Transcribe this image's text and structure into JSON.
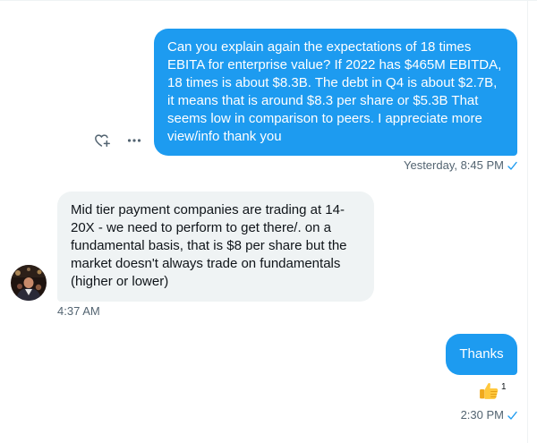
{
  "conversation": {
    "messages": [
      {
        "direction": "outgoing",
        "text": "Can you explain again the expectations of 18 times EBITA for enterprise value? If 2022 has $465M EBITDA, 18 times is about $8.3B. The debt in Q4 is about $2.7B, it means that is around $8.3 per share or $5.3B That seems low in comparison to peers. I appreciate more view/info thank you",
        "timestamp": "Yesterday, 8:45 PM",
        "icons": {
          "react": "heart-plus-icon",
          "more": "more-options-icon",
          "status": "checkmark-icon"
        }
      },
      {
        "direction": "incoming",
        "text": "Mid tier payment companies are trading at 14-20X - we need to perform to get there/. on a fundamental basis, that is $8 per share but the market doesn't always trade on fundamentals (higher or lower)",
        "timestamp": "4:37 AM",
        "icons": {
          "avatar": "user-avatar"
        }
      },
      {
        "direction": "outgoing",
        "text": "Thanks",
        "timestamp": "2:30 PM",
        "reaction": {
          "emoji": "thumbs-up-icon",
          "count": "1"
        },
        "icons": {
          "status": "checkmark-icon"
        }
      }
    ]
  },
  "colors": {
    "accent": "#1d9bf0",
    "incoming_bubble": "#eff3f4",
    "meta_text": "#536471",
    "reaction": "#f5b02b"
  }
}
